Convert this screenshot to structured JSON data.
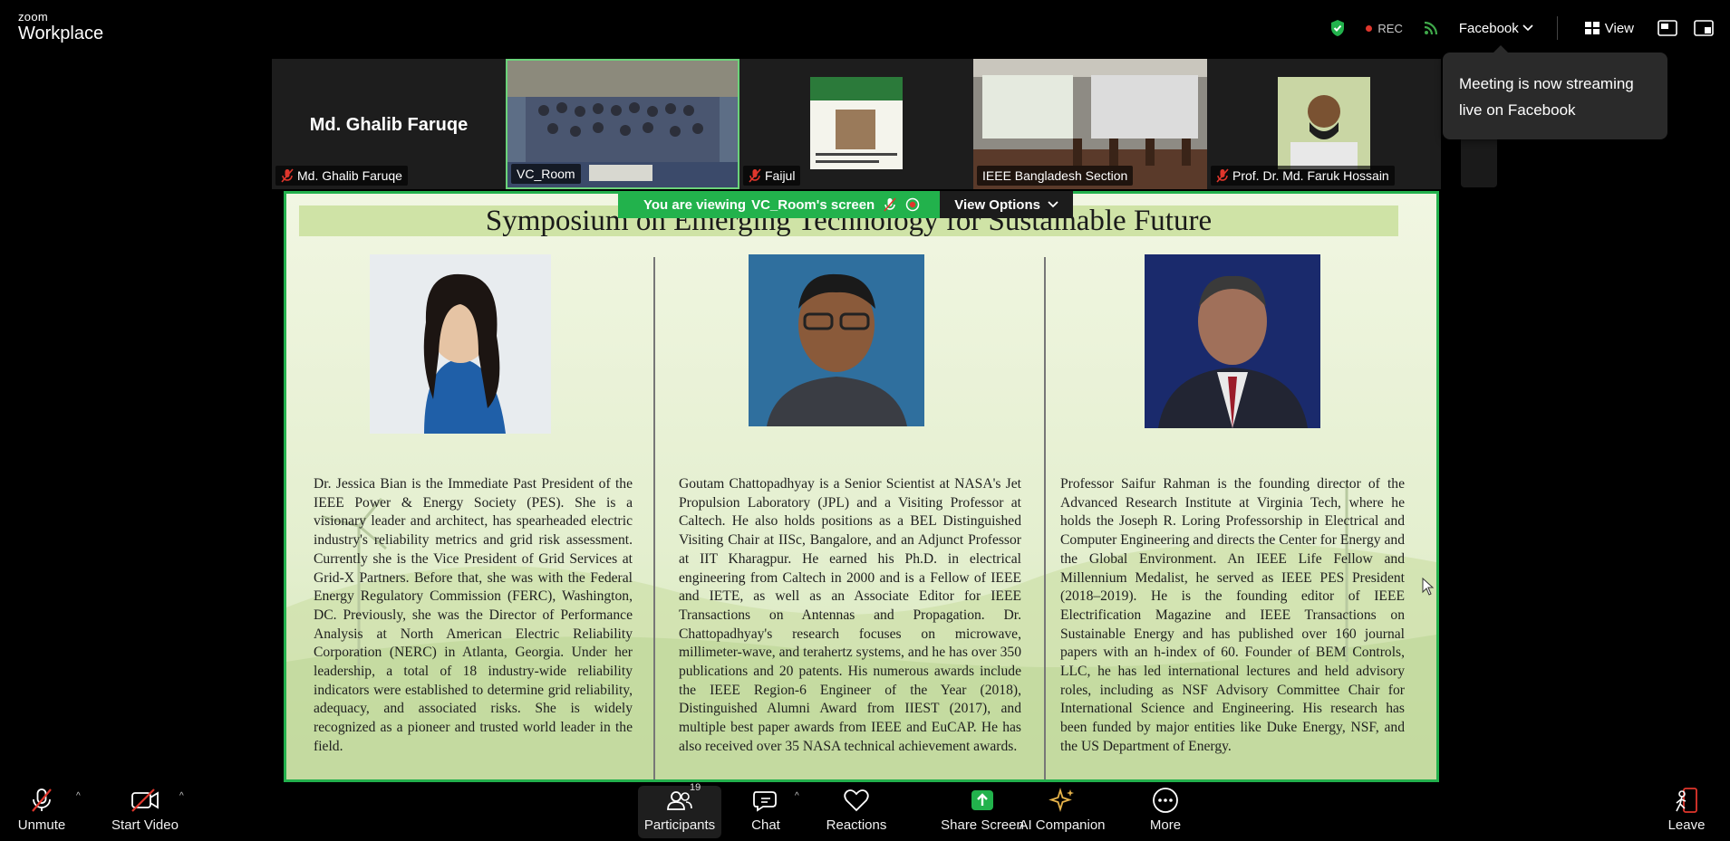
{
  "app": {
    "brand_small": "zoom",
    "brand_big": "Workplace"
  },
  "topbar": {
    "rec_label": "REC",
    "stream_target": "Facebook",
    "view_label": "View"
  },
  "tooltip": {
    "text": "Meeting is now streaming live on Facebook"
  },
  "gallery": {
    "tiles": [
      {
        "name": "Md. Ghalib Faruqe",
        "big_name": "Md. Ghalib Faruqe",
        "muted": true
      },
      {
        "name": "VC_Room",
        "muted": false
      },
      {
        "name": "Faijul",
        "muted": true
      },
      {
        "name": "IEEE Bangladesh Section",
        "muted": false
      },
      {
        "name": "Prof. Dr. Md. Faruk Hossain",
        "muted": true
      }
    ]
  },
  "viewing_banner": {
    "prefix": "You are viewing",
    "name": "VC_Room's screen",
    "options_label": "View Options"
  },
  "slide": {
    "title": "Symposium on Emerging Technology for Sustainable Future",
    "speakers": [
      {
        "bio": "Dr. Jessica Bian is the Immediate Past President of the IEEE Power & Energy Society (PES). She is a visionary leader and architect, has spearheaded electric industry's reliability metrics and grid risk assessment. Currently she is the Vice President of Grid Services at Grid-X Partners. Before that, she was with the Federal Energy Regulatory Commission (FERC), Washington, DC. Previously, she was the Director of Performance Analysis at North American Electric Reliability Corporation (NERC) in Atlanta, Georgia. Under her leadership, a total of 18 industry-wide reliability indicators were established to determine grid reliability, adequacy, and associated risks. She is widely recognized as a pioneer and trusted world leader in the field."
      },
      {
        "bio": "Goutam Chattopadhyay is a Senior Scientist at NASA's Jet Propulsion Laboratory (JPL) and a Visiting Professor at Caltech. He also holds positions as a BEL Distinguished Visiting Chair at IISc, Bangalore, and an Adjunct Professor at IIT Kharagpur. He earned his Ph.D. in electrical engineering from Caltech in 2000 and is a Fellow of IEEE and IETE, as well as an Associate Editor for IEEE Transactions on Antennas and Propagation. Dr. Chattopadhyay's research focuses on microwave, millimeter-wave, and terahertz systems, and he has over 350 publications and 20 patents. His numerous awards include the IEEE Region-6 Engineer of the Year (2018), Distinguished Alumni Award from IIEST (2017), and multiple best paper awards from IEEE and EuCAP. He has also received over 35 NASA technical achievement awards."
      },
      {
        "bio": "Professor Saifur Rahman is the founding director of the Advanced Research Institute at Virginia Tech, where he holds the Joseph R. Loring Professorship in Electrical and Computer Engineering and directs the Center for Energy and the Global Environment. An IEEE Life Fellow and Millennium Medalist, he served as IEEE PES President (2018–2019). He is the founding editor of IEEE Electrification Magazine and IEEE Transactions on Sustainable Energy and has published over 160 journal papers with an h-index of 60. Founder of BEM Controls, LLC, he has led international lectures and held advisory roles, including as NSF Advisory Committee Chair for International Science and Engineering. His research has been funded by major entities like Duke Energy, NSF, and the US Department of Energy."
      }
    ]
  },
  "toolbar": {
    "unmute": "Unmute",
    "start_video": "Start Video",
    "participants": "Participants",
    "participants_count": "19",
    "chat": "Chat",
    "reactions": "Reactions",
    "share_screen": "Share Screen",
    "ai_companion": "AI Companion",
    "more": "More",
    "leave": "Leave"
  },
  "colors": {
    "accent_green": "#22b24c",
    "rec_red": "#e0362c",
    "stream_green": "#3fa84a"
  }
}
